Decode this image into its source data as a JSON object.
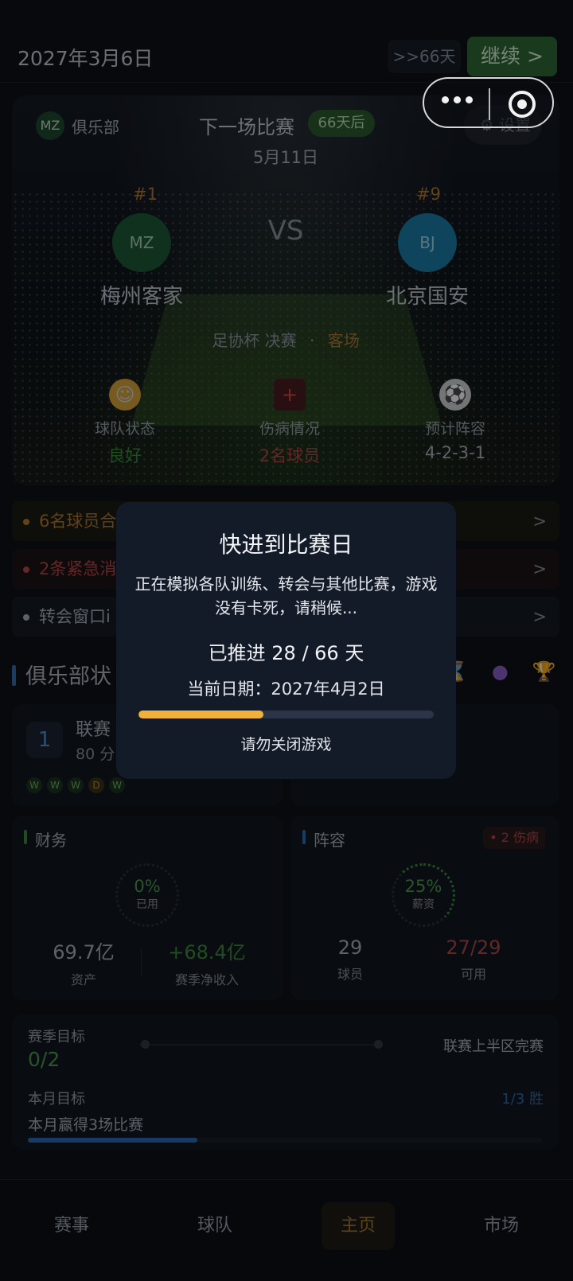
{
  "header": {
    "date": "2027年3月6日",
    "skip_label": ">>66天",
    "continue_label": "继续 >"
  },
  "match": {
    "club_badge": "MZ",
    "club_label": "俱乐部",
    "title": "下一场比赛",
    "days_badge": "66天后",
    "date": "5月11日",
    "settings_label": "设置",
    "home": {
      "rank": "#1",
      "logo": "MZ",
      "name": "梅州客家",
      "color": "#1e5a36"
    },
    "away": {
      "rank": "#9",
      "logo": "BJ",
      "name": "北京国安",
      "color": "#1a7fa8"
    },
    "vs": "VS",
    "competition": "足协杯 决赛",
    "separator": "·",
    "venue": "客场",
    "stats": [
      {
        "label": "球队状态",
        "value": "良好",
        "icon": "smile-icon",
        "color": "#3c8a3c"
      },
      {
        "label": "伤病情况",
        "value": "2名球员",
        "icon": "medical-cross-icon",
        "color": "#b34848"
      },
      {
        "label": "预计阵容",
        "value": "4-2-3-1",
        "icon": "soccer-ball-icon",
        "color": "#aab3be"
      }
    ]
  },
  "alerts": [
    {
      "text": "6名球员合",
      "color": "#b3782d",
      "bg": "#1b1a14"
    },
    {
      "text": "2条紧急消",
      "color": "#b34848",
      "bg": "#1d1416"
    },
    {
      "text": "转会窗口i",
      "color": "#aab3be",
      "bg": "#151a22"
    }
  ],
  "alert_arrow": ">",
  "club_status": {
    "title": "俱乐部状",
    "icons": [
      "hourglass-icon",
      "crystal-ball-icon",
      "trophy-icon"
    ]
  },
  "league": {
    "position": "1",
    "label": "联赛",
    "points": "80 分",
    "form": [
      "W",
      "W",
      "W",
      "D",
      "W"
    ]
  },
  "finance": {
    "title": "财务",
    "ring_pct": "0%",
    "ring_label": "已用",
    "assets_value": "69.7亿",
    "assets_label": "资产",
    "income_value": "+68.4亿",
    "income_label": "赛季净收入"
  },
  "squad": {
    "title": "阵容",
    "injury_tag": "• 2 伤病",
    "ring_pct": "25%",
    "ring_label": "薪资",
    "players_value": "29",
    "players_label": "球员",
    "available_value": "27/29",
    "available_label": "可用"
  },
  "goals": {
    "season_title": "赛季目标",
    "season_value": "0/2",
    "season_desc": "联赛上半区完赛",
    "month_title": "本月目标",
    "month_desc": "本月赢得3场比赛",
    "month_wins": "1/3 胜",
    "month_progress": 0.33
  },
  "tabs": [
    "赛事",
    "球队",
    "主页",
    "市场"
  ],
  "active_tab": 2,
  "modal": {
    "title": "快进到比赛日",
    "description": "正在模拟各队训练、转会与其他比赛，游戏没有卡死，请稍候...",
    "progress_text": "已推进 28 / 66 天",
    "current_date": "当前日期：2027年4月2日",
    "progress_fraction": 0.4242,
    "warning": "请勿关闭游戏"
  }
}
